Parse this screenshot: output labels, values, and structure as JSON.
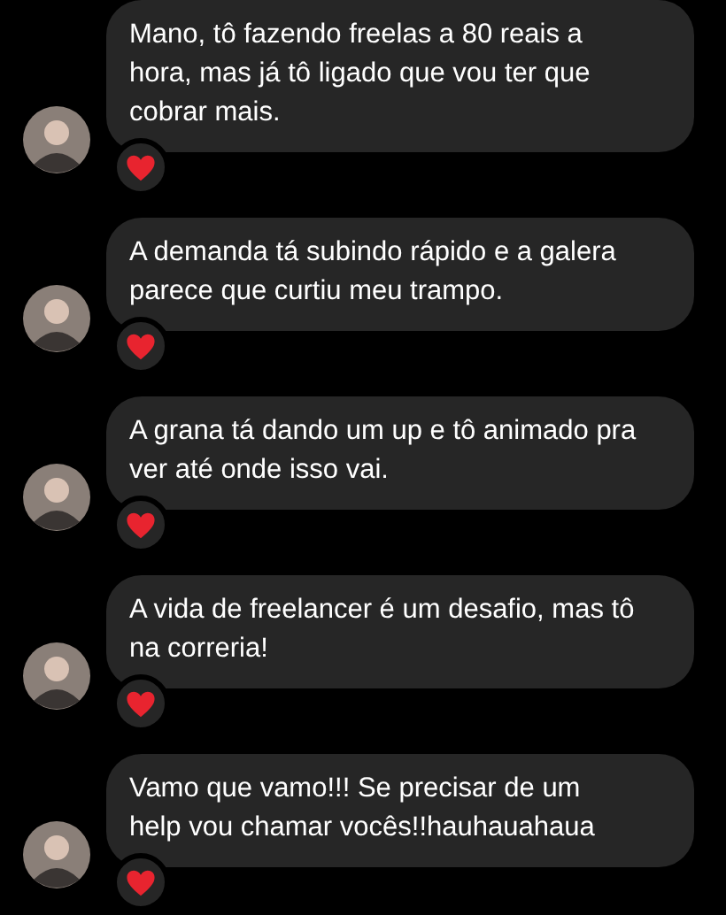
{
  "messages": [
    {
      "text": "Mano, tô fazendo freelas a 80 reais a hora, mas já tô ligado que vou ter que cobrar mais.",
      "reacted": true
    },
    {
      "text": "A demanda tá subindo rápido e a galera parece que curtiu meu trampo.",
      "reacted": true
    },
    {
      "text": "A grana tá dando um up e tô animado pra ver até onde isso vai.",
      "reacted": true
    },
    {
      "text": "A vida de freelancer é um desafio, mas tô na correria!",
      "reacted": true
    },
    {
      "text": "Vamo que vamo!!! Se precisar de um help vou chamar vocês!!hauhauahaua",
      "reacted": true
    }
  ]
}
